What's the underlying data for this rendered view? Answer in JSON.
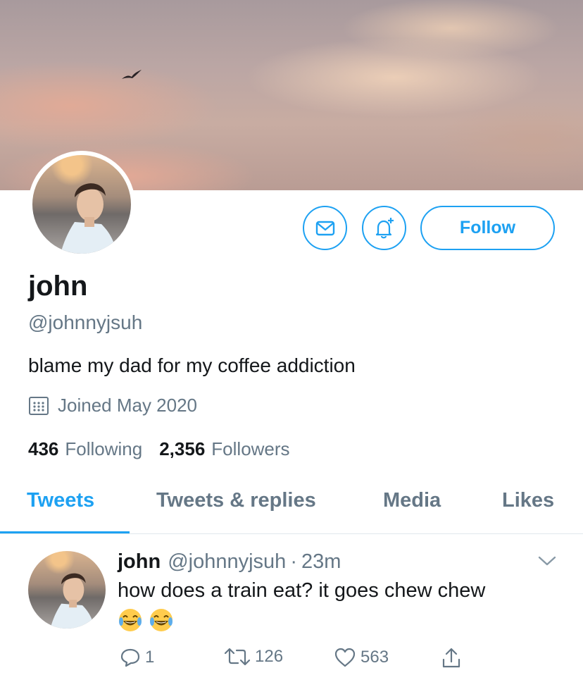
{
  "profile": {
    "name": "john",
    "handle": "@johnnyjsuh",
    "bio": "blame my dad for my coffee addiction",
    "joined": "Joined May 2020",
    "following_count": "436",
    "following_label": "Following",
    "followers_count": "2,356",
    "followers_label": "Followers",
    "follow_label": "Follow"
  },
  "tabs": [
    {
      "label": "Tweets",
      "active": true
    },
    {
      "label": "Tweets & replies",
      "active": false
    },
    {
      "label": "Media",
      "active": false
    },
    {
      "label": "Likes",
      "active": false
    }
  ],
  "tweet": {
    "name": "john",
    "handle": "@johnnyjsuh",
    "separator": "·",
    "time": "23m",
    "text": "how does a train eat? it goes chew chew",
    "emojis": [
      "😂",
      "😂"
    ],
    "replies": "1",
    "retweets": "126",
    "likes": "563"
  },
  "icons": [
    "mail-icon",
    "bell-plus-icon",
    "calendar-icon",
    "chevron-down-icon",
    "reply-icon",
    "retweet-icon",
    "heart-icon",
    "share-icon"
  ],
  "colors": {
    "accent": "#1da1f2",
    "secondary_text": "#657786",
    "primary_text": "#14171a"
  }
}
